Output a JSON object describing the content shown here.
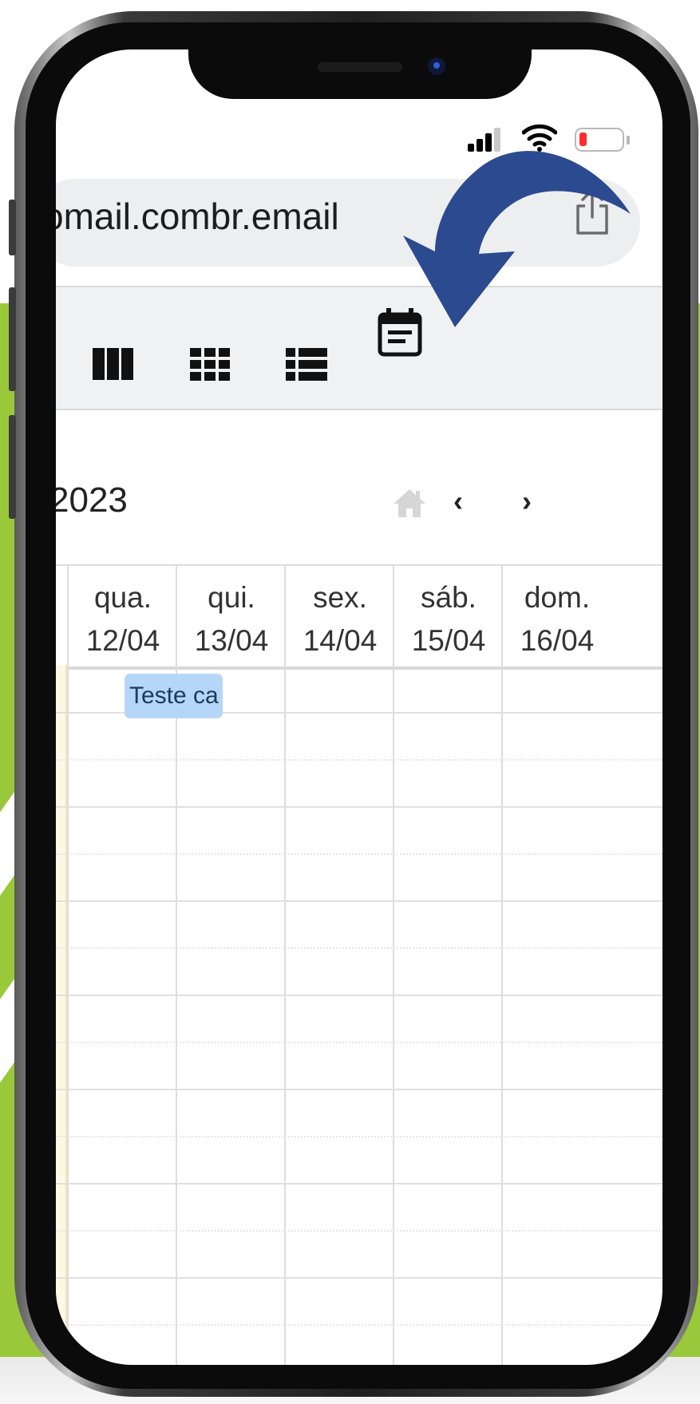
{
  "browser": {
    "url": "omail.combr.email"
  },
  "toolbar": {
    "views": [
      {
        "icon": "week-columns-icon"
      },
      {
        "icon": "month-grid-icon"
      },
      {
        "icon": "list-view-icon"
      },
      {
        "icon": "agenda-calendar-icon"
      }
    ]
  },
  "calendar": {
    "title": "2023",
    "prev_label": "‹",
    "next_label": "›",
    "days": [
      {
        "weekday": "qua.",
        "date": "12/04"
      },
      {
        "weekday": "qui.",
        "date": "13/04"
      },
      {
        "weekday": "sex.",
        "date": "14/04"
      },
      {
        "weekday": "sáb.",
        "date": "15/04"
      },
      {
        "weekday": "dom.",
        "date": "16/04"
      }
    ],
    "event": {
      "title": "Teste ca"
    }
  },
  "colors": {
    "background_green": "#99c93a",
    "arrow_blue": "#2c4a8f",
    "event_blue": "#b5d6f8",
    "battery_red": "#ff2d2d"
  }
}
